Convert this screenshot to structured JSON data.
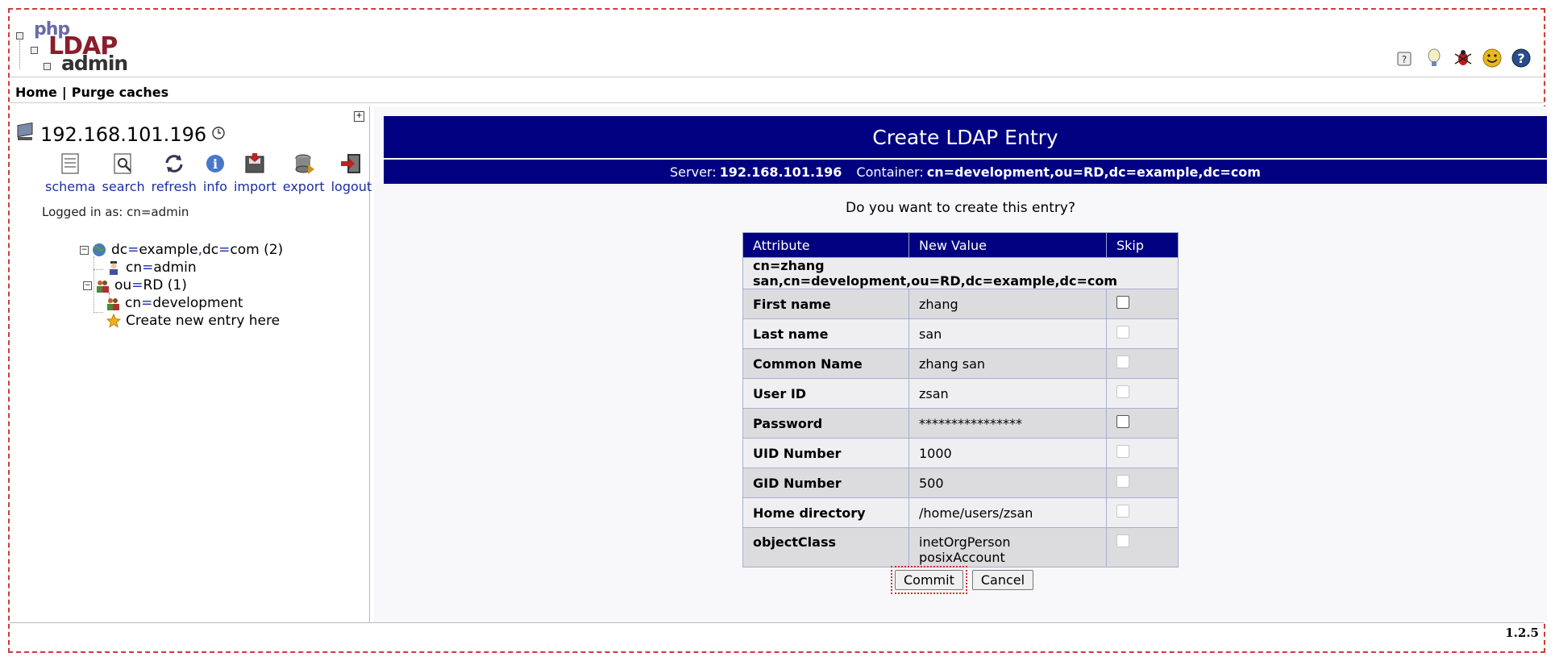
{
  "header": {
    "logo_php": "php",
    "logo_ldap": "LDAP",
    "logo_admin": "admin",
    "icons": [
      "help-icon",
      "lightbulb-icon",
      "bug-icon",
      "smiley-icon",
      "question-icon"
    ]
  },
  "menu": {
    "home": "Home",
    "separator": "|",
    "purge": "Purge caches"
  },
  "server": {
    "name": "192.168.101.196",
    "logged_in": "Logged in as: cn=admin"
  },
  "actions": [
    {
      "label": "schema",
      "icon": "schema-icon"
    },
    {
      "label": "search",
      "icon": "search-icon"
    },
    {
      "label": "refresh",
      "icon": "refresh-icon"
    },
    {
      "label": "info",
      "icon": "info-icon"
    },
    {
      "label": "import",
      "icon": "import-icon"
    },
    {
      "label": "export",
      "icon": "export-icon"
    },
    {
      "label": "logout",
      "icon": "logout-icon"
    }
  ],
  "tree": {
    "root_a": "dc",
    "root_b": "example",
    "root_c": "dc",
    "root_d": "com (2)",
    "admin_a": "cn",
    "admin_b": "admin",
    "ou_a": "ou",
    "ou_b": "RD (1)",
    "dev_a": "cn",
    "dev_b": "development",
    "create": "Create new entry here"
  },
  "main": {
    "title": "Create LDAP Entry",
    "server_label": "Server:",
    "server_value": "192.168.101.196",
    "container_label": "Container:",
    "container_value": "cn=development,ou=RD,dc=example,dc=com",
    "question": "Do you want to create this entry?",
    "col_attribute": "Attribute",
    "col_value": "New Value",
    "col_skip": "Skip",
    "dn": "cn=zhang san,cn=development,ou=RD,dc=example,dc=com",
    "rows": [
      {
        "label": "First name",
        "value": "zhang"
      },
      {
        "label": "Last name",
        "value": "san"
      },
      {
        "label": "Common Name",
        "value": "zhang san"
      },
      {
        "label": "User ID",
        "value": "zsan"
      },
      {
        "label": "Password",
        "value": "****************"
      },
      {
        "label": "UID Number",
        "value": "1000"
      },
      {
        "label": "GID Number",
        "value": "500"
      },
      {
        "label": "Home directory",
        "value": "/home/users/zsan"
      },
      {
        "label": "objectClass",
        "value": "inetOrgPerson",
        "value2": "posixAccount"
      }
    ],
    "commit": "Commit",
    "cancel": "Cancel"
  },
  "footer": {
    "version": "1.2.5"
  }
}
